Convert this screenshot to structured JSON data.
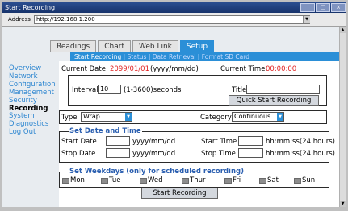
{
  "window": {
    "title": "Start Recording"
  },
  "address": {
    "label": "Address",
    "url": "http://192.168.1.200"
  },
  "tabs": [
    {
      "label": "Readings"
    },
    {
      "label": "Chart"
    },
    {
      "label": "Web Link"
    },
    {
      "label": "Setup"
    }
  ],
  "subnav": {
    "current": "Start Recording",
    "sep": "|",
    "items": [
      "Status",
      "Data Retrieval",
      "Format SD Card"
    ]
  },
  "sidebar": [
    {
      "label": "Overview"
    },
    {
      "label": "Network"
    },
    {
      "label": "Configuration"
    },
    {
      "label": "Management"
    },
    {
      "label": "Security"
    },
    {
      "label": "Recording"
    },
    {
      "label": "System"
    },
    {
      "label": "Diagnostics"
    },
    {
      "label": "Log Out"
    }
  ],
  "header": {
    "current_date_label": "Current Date:",
    "current_date_value": "2099/01/01",
    "date_format": "(yyyy/mm/dd)",
    "current_time_label": "Current Time:",
    "current_time_value": "00:00:00"
  },
  "interval": {
    "label": "Interval",
    "value": "10",
    "range": "(1-3600)seconds"
  },
  "title_field": {
    "label": "Title",
    "value": ""
  },
  "quick_start": {
    "label": "Quick Start Recording"
  },
  "type": {
    "label": "Type",
    "value": "Wrap"
  },
  "category": {
    "label": "Category",
    "value": "Continuous"
  },
  "date_time": {
    "legend": "Set Date and Time",
    "start_date_label": "Start Date",
    "stop_date_label": "Stop Date",
    "date_hint": "yyyy/mm/dd",
    "start_time_label": "Start Time",
    "stop_time_label": "Stop Time",
    "time_hint": "hh:mm:ss(24 hours)"
  },
  "weekdays": {
    "legend": "Set Weekdays (only for scheduled recording)",
    "days": [
      "Mon",
      "Tue",
      "Wed",
      "Thur",
      "Fri",
      "Sat",
      "Sun"
    ]
  },
  "start_button": {
    "label": "Start Recording"
  },
  "colors": {
    "accent": "#2b8fd7",
    "link": "#2b85d0",
    "alert": "#e02020",
    "legend": "#2b5fb0"
  }
}
